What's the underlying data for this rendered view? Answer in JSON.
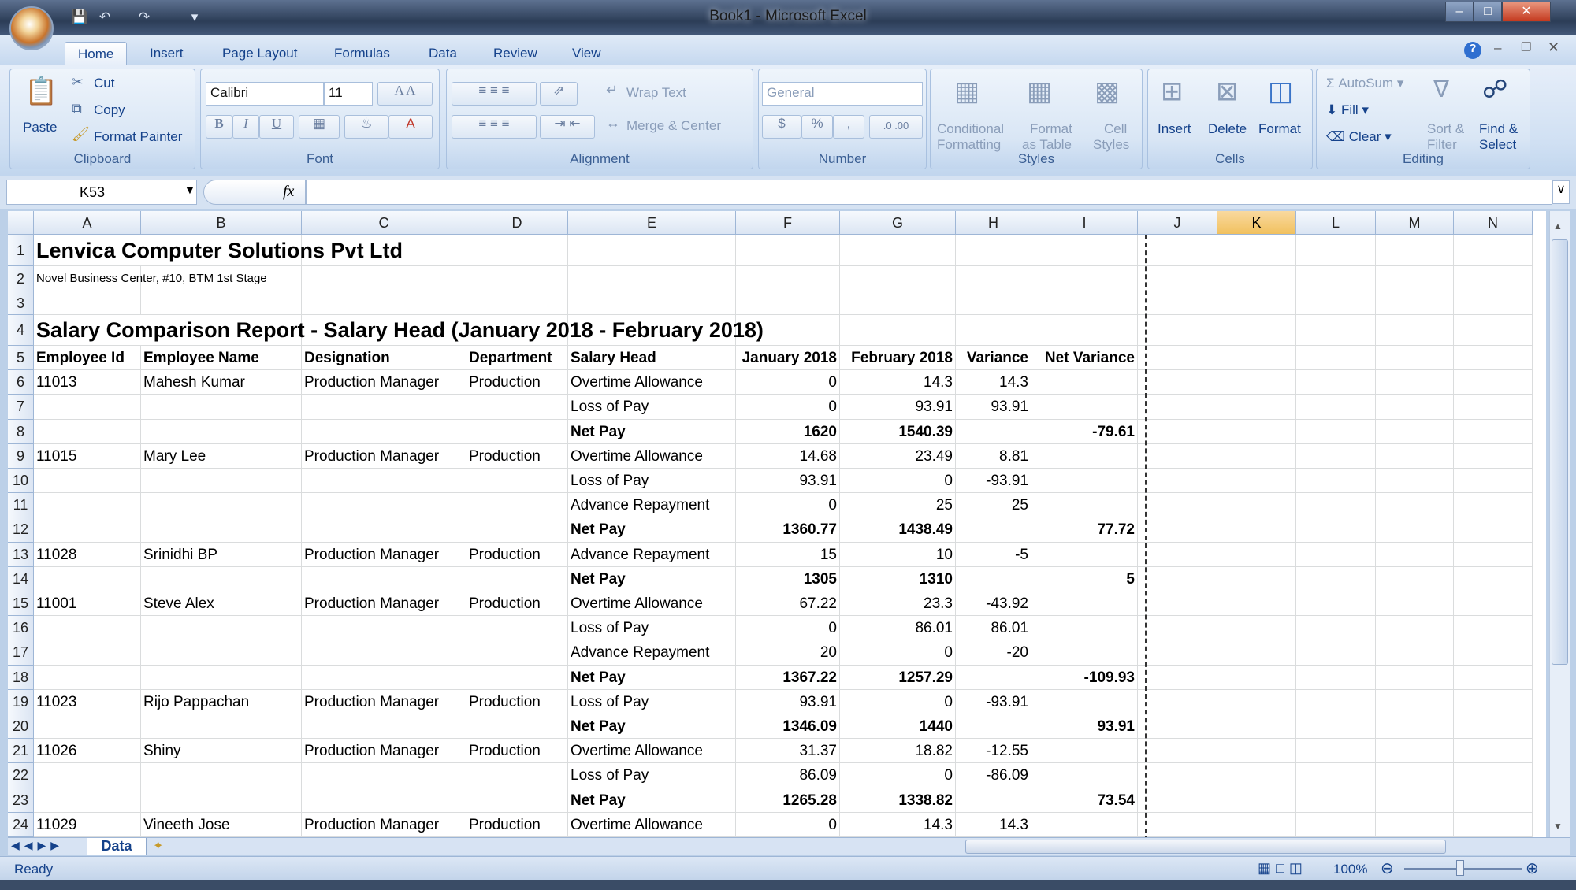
{
  "window": {
    "title": "Book1 - Microsoft Excel"
  },
  "tabs": [
    "Home",
    "Insert",
    "Page Layout",
    "Formulas",
    "Data",
    "Review",
    "View"
  ],
  "clipboard": {
    "paste": "Paste",
    "cut": "Cut",
    "copy": "Copy",
    "format_painter": "Format Painter",
    "label": "Clipboard"
  },
  "font": {
    "name": "Calibri",
    "size": "11",
    "bold": "B",
    "italic": "I",
    "underline": "U",
    "label": "Font"
  },
  "alignment": {
    "wrap": "Wrap Text",
    "merge": "Merge & Center",
    "label": "Alignment"
  },
  "number": {
    "format": "General",
    "currency": "$",
    "percent": "%",
    "comma": ",",
    "label": "Number"
  },
  "styles": {
    "conditional1": "Conditional",
    "conditional2": "Formatting",
    "table1": "Format",
    "table2": "as Table",
    "cell1": "Cell",
    "cell2": "Styles",
    "label": "Styles"
  },
  "cells": {
    "insert": "Insert",
    "delete": "Delete",
    "format": "Format",
    "label": "Cells"
  },
  "editing": {
    "autosum": "AutoSum",
    "fill": "Fill",
    "clear": "Clear",
    "sort1": "Sort &",
    "sort2": "Filter",
    "find1": "Find &",
    "find2": "Select",
    "label": "Editing"
  },
  "formula_bar": {
    "name_box": "K53",
    "fx": "fx",
    "value": ""
  },
  "columns": [
    "A",
    "B",
    "C",
    "D",
    "E",
    "F",
    "G",
    "H",
    "I",
    "J",
    "K",
    "L",
    "M",
    "N"
  ],
  "selected_column": "K",
  "rows": [
    {
      "n": "1",
      "A": "Lenvica Computer Solutions Pvt Ltd",
      "style": "title"
    },
    {
      "n": "2",
      "A": "Novel Business Center, #10, BTM 1st Stage",
      "style": "small"
    },
    {
      "n": "3"
    },
    {
      "n": "4",
      "A": "Salary Comparison Report - Salary Head (January 2018 - February 2018)",
      "style": "title"
    },
    {
      "n": "5",
      "A": "Employee Id",
      "B": "Employee Name",
      "C": "Designation",
      "D": "Department",
      "E": "Salary Head",
      "F": "January 2018",
      "G": "February 2018",
      "H": "Variance",
      "I": "Net Variance",
      "style": "header"
    },
    {
      "n": "6",
      "A": "11013",
      "B": "Mahesh Kumar",
      "C": "Production Manager",
      "D": "Production",
      "E": "Overtime Allowance",
      "F": "0",
      "G": "14.3",
      "H": "14.3"
    },
    {
      "n": "7",
      "E": "Loss of Pay",
      "F": "0",
      "G": "93.91",
      "H": "93.91"
    },
    {
      "n": "8",
      "E": "Net Pay",
      "F": "1620",
      "G": "1540.39",
      "I": "-79.61",
      "style": "net"
    },
    {
      "n": "9",
      "A": "11015",
      "B": "Mary Lee",
      "C": "Production Manager",
      "D": "Production",
      "E": "Overtime Allowance",
      "F": "14.68",
      "G": "23.49",
      "H": "8.81"
    },
    {
      "n": "10",
      "E": "Loss of Pay",
      "F": "93.91",
      "G": "0",
      "H": "-93.91"
    },
    {
      "n": "11",
      "E": "Advance Repayment",
      "F": "0",
      "G": "25",
      "H": "25"
    },
    {
      "n": "12",
      "E": "Net Pay",
      "F": "1360.77",
      "G": "1438.49",
      "I": "77.72",
      "style": "net"
    },
    {
      "n": "13",
      "A": "11028",
      "B": "Srinidhi BP",
      "C": "Production Manager",
      "D": "Production",
      "E": "Advance Repayment",
      "F": "15",
      "G": "10",
      "H": "-5"
    },
    {
      "n": "14",
      "E": "Net Pay",
      "F": "1305",
      "G": "1310",
      "I": "5",
      "style": "net"
    },
    {
      "n": "15",
      "A": "11001",
      "B": "Steve Alex",
      "C": "Production Manager",
      "D": "Production",
      "E": "Overtime Allowance",
      "F": "67.22",
      "G": "23.3",
      "H": "-43.92"
    },
    {
      "n": "16",
      "E": "Loss of Pay",
      "F": "0",
      "G": "86.01",
      "H": "86.01"
    },
    {
      "n": "17",
      "E": "Advance Repayment",
      "F": "20",
      "G": "0",
      "H": "-20"
    },
    {
      "n": "18",
      "E": "Net Pay",
      "F": "1367.22",
      "G": "1257.29",
      "I": "-109.93",
      "style": "net"
    },
    {
      "n": "19",
      "A": "11023",
      "B": "Rijo Pappachan",
      "C": "Production Manager",
      "D": "Production",
      "E": "Loss of Pay",
      "F": "93.91",
      "G": "0",
      "H": "-93.91"
    },
    {
      "n": "20",
      "E": "Net Pay",
      "F": "1346.09",
      "G": "1440",
      "I": "93.91",
      "style": "net"
    },
    {
      "n": "21",
      "A": "11026",
      "B": "Shiny",
      "C": "Production Manager",
      "D": "Production",
      "E": "Overtime Allowance",
      "F": "31.37",
      "G": "18.82",
      "H": "-12.55"
    },
    {
      "n": "22",
      "E": "Loss of Pay",
      "F": "86.09",
      "G": "0",
      "H": "-86.09"
    },
    {
      "n": "23",
      "E": "Net Pay",
      "F": "1265.28",
      "G": "1338.82",
      "I": "73.54",
      "style": "net"
    },
    {
      "n": "24",
      "A": "11029",
      "B": "Vineeth Jose",
      "C": "Production Manager",
      "D": "Production",
      "E": "Overtime Allowance",
      "F": "0",
      "G": "14.3",
      "H": "14.3"
    }
  ],
  "sheet_tabs": [
    "Data"
  ],
  "status": {
    "text": "Ready",
    "zoom": "100%"
  }
}
